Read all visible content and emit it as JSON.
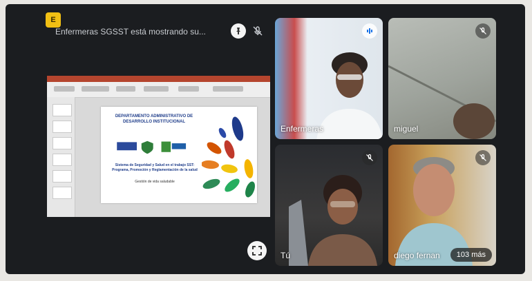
{
  "presenter": {
    "badge": "E",
    "text": "Enfermeras SGSST está mostrando su..."
  },
  "slide": {
    "title": "DEPARTAMENTO ADMINISTRATIVO DE DESARROLLO INSTITUCIONAL",
    "body": "Sistema de Seguridad y Salud en el trabajo SST: Programa, Promoción y Reglamentación de la salud",
    "sub": "Gestión de vida saludable"
  },
  "participants": [
    {
      "name": "Enfermeras",
      "muted": false
    },
    {
      "name": "miguel",
      "muted": true
    },
    {
      "name": "Tú",
      "muted": true
    },
    {
      "name": "diego fernan",
      "muted": true
    }
  ],
  "more_count": "103 más",
  "icons": {
    "pin": "pin-icon",
    "mute": "mic-off-icon",
    "expand": "fullscreen-icon",
    "speaking": "audio-wave-icon"
  }
}
